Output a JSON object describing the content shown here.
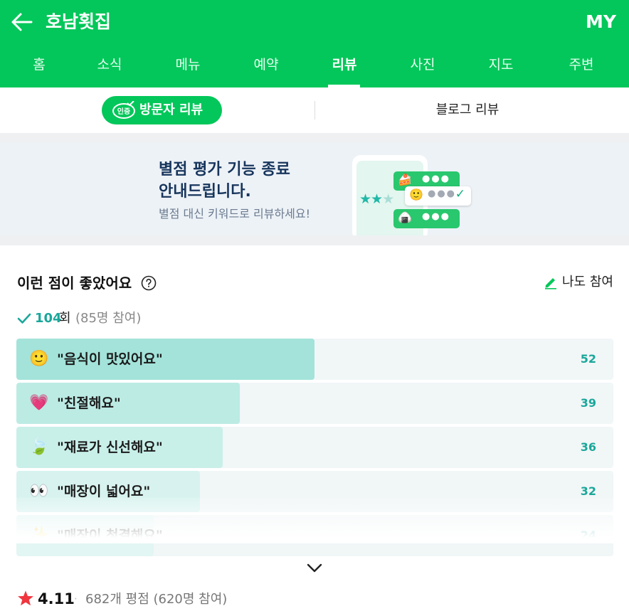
{
  "header": {
    "title": "호남횟집",
    "my_label": "MY",
    "back_icon": "arrow-left-icon",
    "background_color": "#03c75a"
  },
  "tabs": [
    {
      "label": "홈",
      "active": false
    },
    {
      "label": "소식",
      "active": false
    },
    {
      "label": "메뉴",
      "active": false
    },
    {
      "label": "예약",
      "active": false
    },
    {
      "label": "리뷰",
      "active": true
    },
    {
      "label": "사진",
      "active": false
    },
    {
      "label": "지도",
      "active": false
    },
    {
      "label": "주변",
      "active": false
    }
  ],
  "subtabs": {
    "badge_text": "인증",
    "visitor_review": "방문자 리뷰",
    "blog_review": "블로그 리뷰"
  },
  "banner": {
    "title": "별점 평가 기능 종료\n안내드립니다.",
    "subtitle": "별점 대신 키워드로 리뷰하세요!"
  },
  "keywords_section": {
    "title": "이런 점이 좋았어요",
    "help_icon": "question-circle-icon",
    "join_label": "나도 참여",
    "join_icon": "pencil-icon",
    "total_count": "104",
    "total_unit": "회",
    "participants": "(85명 참여)",
    "accent_color": "#1aa79a",
    "items": [
      {
        "emoji": "🙂",
        "label": "\"음식이 맛있어요\"",
        "count": "52",
        "value": 52
      },
      {
        "emoji": "💗",
        "label": "\"친절해요\"",
        "count": "39",
        "value": 39
      },
      {
        "emoji": "🍃",
        "label": "\"재료가 신선해요\"",
        "count": "36",
        "value": 36
      },
      {
        "emoji": "👀",
        "label": "\"매장이 넓어요\"",
        "count": "32",
        "value": 32
      },
      {
        "emoji": "✨",
        "label": "\"매장이 청결해요\"",
        "count": "24",
        "value": 24
      }
    ],
    "expand_icon": "chevron-down-icon"
  },
  "rating": {
    "star_icon": "star-icon",
    "star_color": "#f0353f",
    "score": "4.11",
    "separator": "·",
    "detail": "682개 평점 (620명 참여)"
  }
}
